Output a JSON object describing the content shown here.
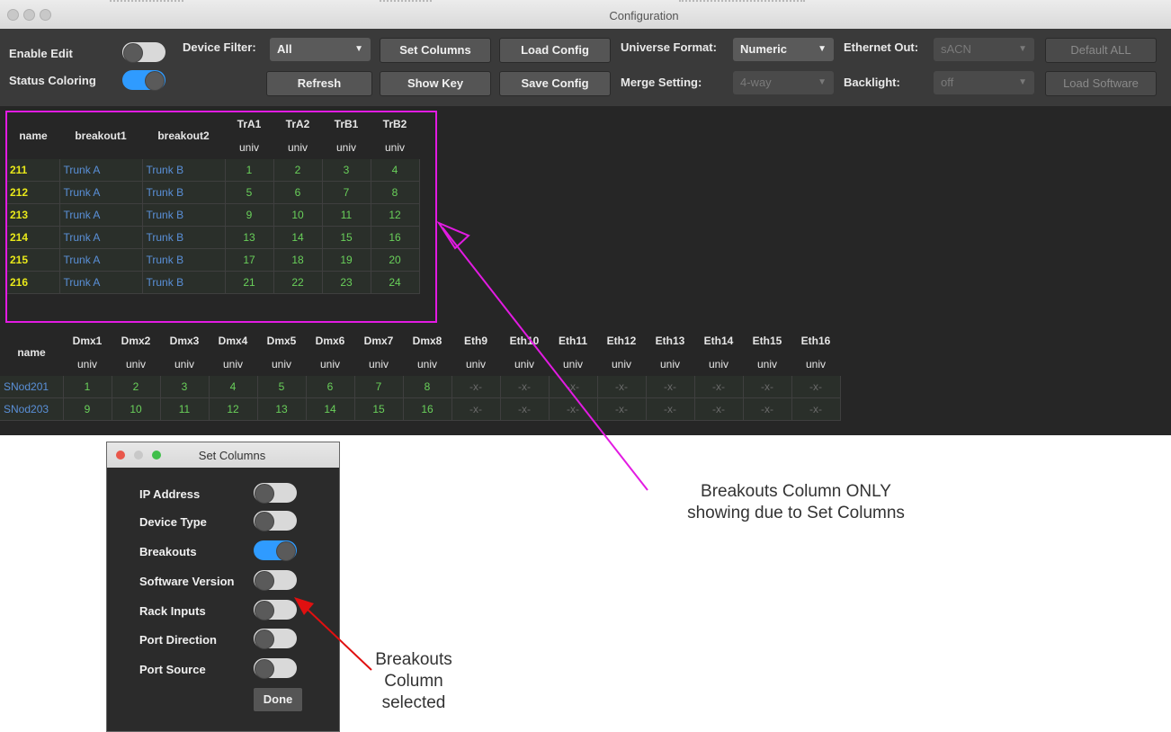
{
  "window": {
    "title": "Configuration"
  },
  "toolbar": {
    "enable_edit_label": "Enable Edit",
    "status_coloring_label": "Status Coloring",
    "device_filter_label": "Device Filter:",
    "device_filter_value": "All",
    "set_columns": "Set Columns",
    "load_config": "Load Config",
    "refresh": "Refresh",
    "show_key": "Show Key",
    "save_config": "Save Config",
    "universe_format_label": "Universe Format:",
    "universe_format_value": "Numeric",
    "merge_setting_label": "Merge Setting:",
    "merge_setting_value": "4-way",
    "ethernet_out_label": "Ethernet Out:",
    "ethernet_out_value": "sACN",
    "backlight_label": "Backlight:",
    "backlight_value": "off",
    "default_all": "Default ALL",
    "load_software": "Load Software"
  },
  "table1": {
    "headers": {
      "name": "name",
      "breakout1": "breakout1",
      "breakout2": "breakout2",
      "cols": [
        "TrA1",
        "TrA2",
        "TrB1",
        "TrB2"
      ],
      "sub": "univ"
    },
    "rows": [
      {
        "name": "211",
        "b1": "Trunk A",
        "b2": "Trunk B",
        "v": [
          "1",
          "2",
          "3",
          "4"
        ]
      },
      {
        "name": "212",
        "b1": "Trunk A",
        "b2": "Trunk B",
        "v": [
          "5",
          "6",
          "7",
          "8"
        ]
      },
      {
        "name": "213",
        "b1": "Trunk A",
        "b2": "Trunk B",
        "v": [
          "9",
          "10",
          "11",
          "12"
        ]
      },
      {
        "name": "214",
        "b1": "Trunk A",
        "b2": "Trunk B",
        "v": [
          "13",
          "14",
          "15",
          "16"
        ]
      },
      {
        "name": "215",
        "b1": "Trunk A",
        "b2": "Trunk B",
        "v": [
          "17",
          "18",
          "19",
          "20"
        ]
      },
      {
        "name": "216",
        "b1": "Trunk A",
        "b2": "Trunk B",
        "v": [
          "21",
          "22",
          "23",
          "24"
        ]
      }
    ]
  },
  "table2": {
    "headers": {
      "name": "name",
      "cols": [
        "Dmx1",
        "Dmx2",
        "Dmx3",
        "Dmx4",
        "Dmx5",
        "Dmx6",
        "Dmx7",
        "Dmx8",
        "Eth9",
        "Eth10",
        "Eth11",
        "Eth12",
        "Eth13",
        "Eth14",
        "Eth15",
        "Eth16"
      ],
      "sub": "univ"
    },
    "rows": [
      {
        "name": "SNod201",
        "v": [
          "1",
          "2",
          "3",
          "4",
          "5",
          "6",
          "7",
          "8",
          "-x-",
          "-x-",
          "-x-",
          "-x-",
          "-x-",
          "-x-",
          "-x-",
          "-x-"
        ]
      },
      {
        "name": "SNod203",
        "v": [
          "9",
          "10",
          "11",
          "12",
          "13",
          "14",
          "15",
          "16",
          "-x-",
          "-x-",
          "-x-",
          "-x-",
          "-x-",
          "-x-",
          "-x-",
          "-x-"
        ]
      }
    ]
  },
  "set_columns_dialog": {
    "title": "Set Columns",
    "options": [
      {
        "label": "IP Address",
        "on": false
      },
      {
        "label": "Device Type",
        "on": false
      },
      {
        "label": "Breakouts",
        "on": true
      },
      {
        "label": "Software Version",
        "on": false
      },
      {
        "label": "Rack Inputs",
        "on": false
      },
      {
        "label": "Port Direction",
        "on": false
      },
      {
        "label": "Port Source",
        "on": false
      }
    ],
    "done": "Done"
  },
  "annotations": {
    "breakouts_showing_line1": "Breakouts Column ONLY",
    "breakouts_showing_line2": "showing due to Set Columns",
    "selected_line1": "Breakouts",
    "selected_line2": "Column",
    "selected_line3": "selected"
  },
  "colors": {
    "accent_blue": "#2f9bff",
    "annotation_magenta": "#e21be2",
    "annotation_red": "#e01010",
    "name_yellow": "#e8e81a",
    "value_green": "#69d05a",
    "trunk_blue": "#5a90d8"
  }
}
